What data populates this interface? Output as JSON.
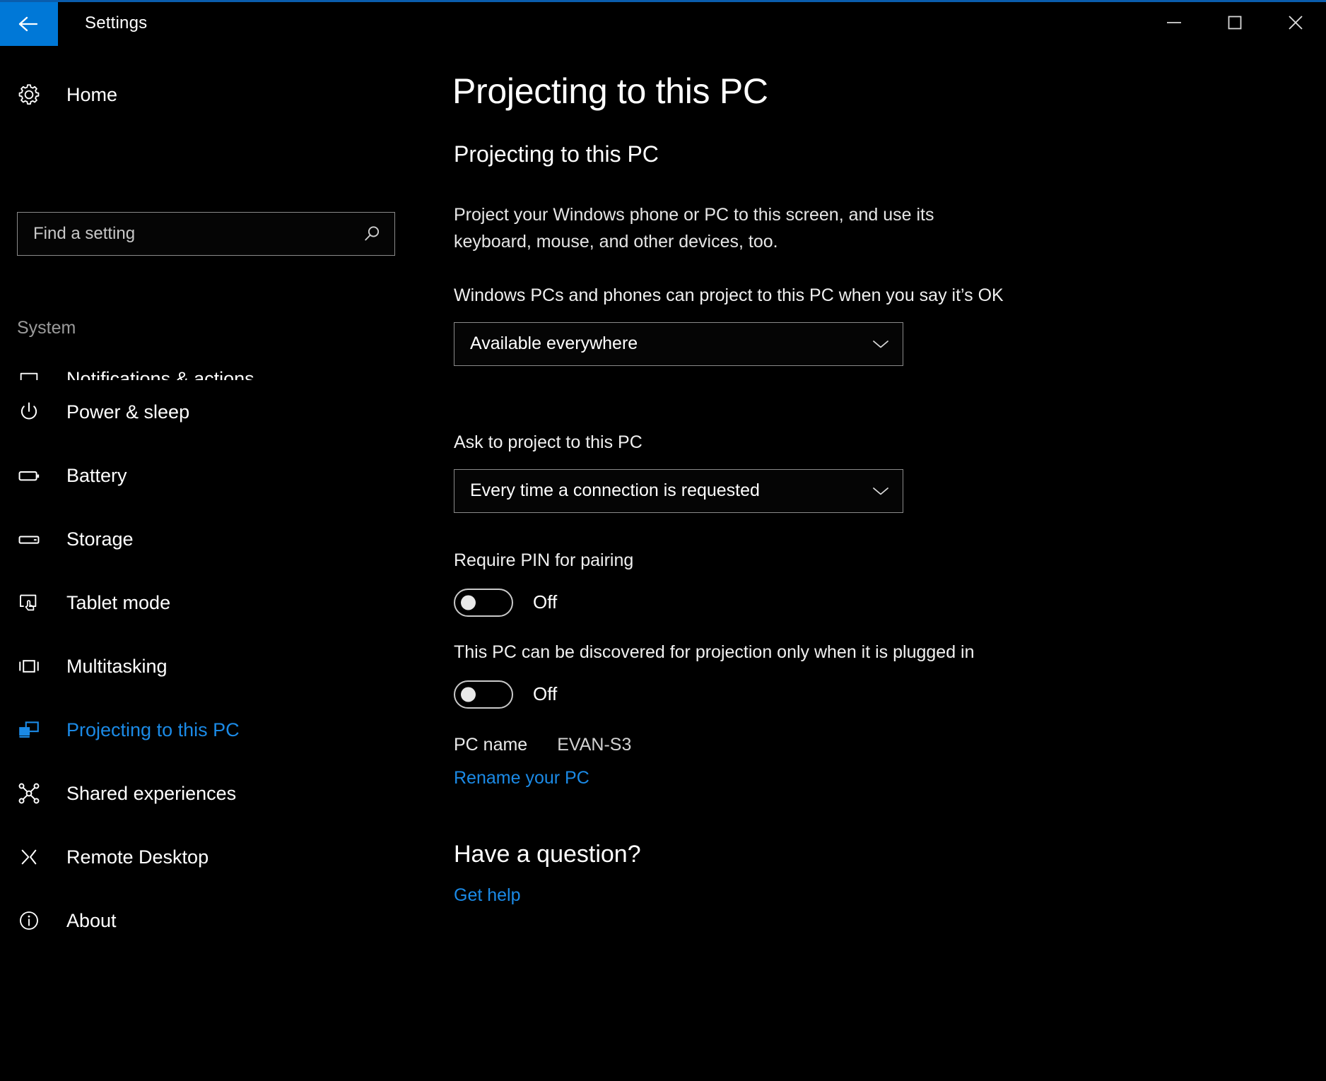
{
  "window": {
    "title": "Settings",
    "back_icon": "back-arrow-icon",
    "minimize_label": "–",
    "maximize_label": "☐",
    "close_label": "✕",
    "accent_color": "#0078d7"
  },
  "sidebar": {
    "home_label": "Home",
    "home_icon": "gear-icon",
    "search": {
      "placeholder": "Find a setting",
      "value": "",
      "icon": "search-icon"
    },
    "section_label": "System",
    "items": [
      {
        "label": "Notifications & actions",
        "icon": "notifications-icon",
        "active": false,
        "clipped": true
      },
      {
        "label": "Power & sleep",
        "icon": "power-icon",
        "active": false,
        "clipped": false
      },
      {
        "label": "Battery",
        "icon": "battery-icon",
        "active": false,
        "clipped": false
      },
      {
        "label": "Storage",
        "icon": "storage-icon",
        "active": false,
        "clipped": false
      },
      {
        "label": "Tablet mode",
        "icon": "tablet-mode-icon",
        "active": false,
        "clipped": false
      },
      {
        "label": "Multitasking",
        "icon": "multitasking-icon",
        "active": false,
        "clipped": false
      },
      {
        "label": "Projecting to this PC",
        "icon": "projecting-icon",
        "active": true,
        "clipped": false
      },
      {
        "label": "Shared experiences",
        "icon": "shared-experiences-icon",
        "active": false,
        "clipped": false
      },
      {
        "label": "Remote Desktop",
        "icon": "remote-desktop-icon",
        "active": false,
        "clipped": false
      },
      {
        "label": "About",
        "icon": "info-icon",
        "active": false,
        "clipped": false
      }
    ],
    "active_color": "#1b8ae6"
  },
  "main": {
    "page_title": "Projecting to this PC",
    "section_heading": "Projecting to this PC",
    "description": "Project your Windows phone or PC to this screen, and use its keyboard, mouse, and other devices, too.",
    "availability": {
      "label": "Windows PCs and phones can project to this PC when you say it’s OK",
      "value": "Available everywhere",
      "arrow_icon": "chevron-down-icon"
    },
    "ask_to_project": {
      "label": "Ask to project to this PC",
      "value": "Every time a connection is requested",
      "arrow_icon": "chevron-down-icon"
    },
    "require_pin": {
      "label": "Require PIN for pairing",
      "state": "Off"
    },
    "plugged_in_only": {
      "label": "This PC can be discovered for projection only when it is plugged in",
      "state": "Off"
    },
    "pc_name": {
      "label": "PC name",
      "value": "EVAN-S3",
      "rename_link": "Rename your PC"
    },
    "help": {
      "heading": "Have a question?",
      "link": "Get help"
    }
  }
}
